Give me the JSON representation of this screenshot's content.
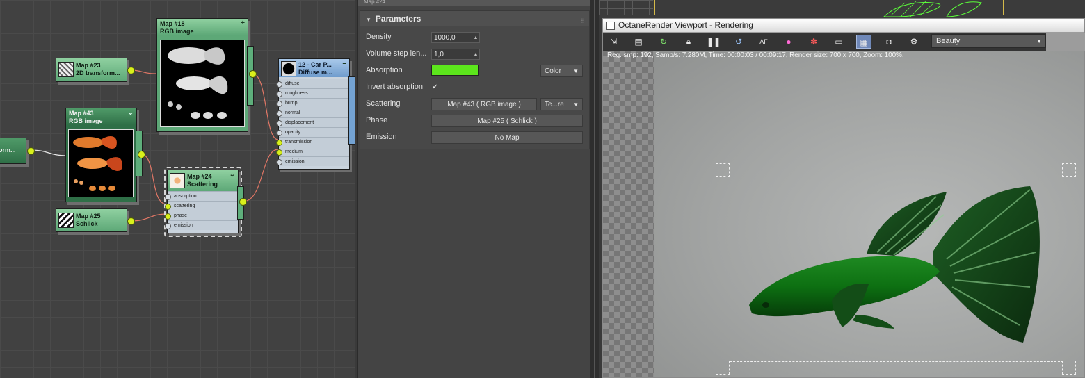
{
  "node_editor": {
    "nodes": {
      "map18": {
        "title": "Map #18",
        "subtitle": "RGB image",
        "corner": "+"
      },
      "map23": {
        "title": "Map #23",
        "subtitle": "2D transform..."
      },
      "map43": {
        "title": "Map #43",
        "subtitle": "RGB image",
        "corner": "⌄"
      },
      "transform_left": {
        "title": "form..."
      },
      "map24": {
        "title": "Map #24",
        "subtitle": "Scattering",
        "corner": "⌄",
        "slots": [
          "absorption",
          "scattering",
          "phase",
          "emission"
        ]
      },
      "map25": {
        "title": "Map #25",
        "subtitle": "Schlick"
      },
      "material": {
        "title": "12 - Car P...",
        "subtitle": "Diffuse m...",
        "corner": "–",
        "slots": [
          "diffuse",
          "roughness",
          "bump",
          "normal",
          "displacement",
          "opacity",
          "transmission",
          "medium",
          "emission"
        ]
      }
    },
    "colors": {
      "wire": "#e27766",
      "port": "#d9f01c",
      "node_green": "#5da877",
      "node_blue": "#6f9ccd"
    }
  },
  "params": {
    "map_name": "Map #24",
    "rollout_title": "Parameters",
    "rows": {
      "density": {
        "label": "Density",
        "value": "1000,0"
      },
      "volume_step": {
        "label": "Volume step len...",
        "value": "1,0"
      },
      "absorption": {
        "label": "Absorption",
        "color": "#5ce51c",
        "mode": "Color"
      },
      "invert_absorption": {
        "label": "Invert absorption",
        "checked": true,
        "check": "✔"
      },
      "scattering": {
        "label": "Scattering",
        "map": "Map #43  ( RGB image )",
        "mode": "Te...re"
      },
      "phase": {
        "label": "Phase",
        "map": "Map #25  ( Schlick )"
      },
      "emission": {
        "label": "Emission",
        "map": "No Map"
      }
    }
  },
  "viewport": {
    "title": "OctaneRender Viewport - Rendering",
    "pass": "Beauty",
    "status": "Reg. smp: 192,   Samp/s: 7.280M,   Time: 00:00:03 / 00:09:17,   Render size: 700 x 700,   Zoom: 100%.",
    "toolbar_icons": [
      "export-icon",
      "copy-icon",
      "refresh-icon",
      "lock-icon",
      "pause-icon",
      "restart-icon",
      "focus-icon",
      "color-icon",
      "clay-icon",
      "region-icon",
      "film-icon",
      "camera-icon",
      "settings-icon"
    ]
  }
}
